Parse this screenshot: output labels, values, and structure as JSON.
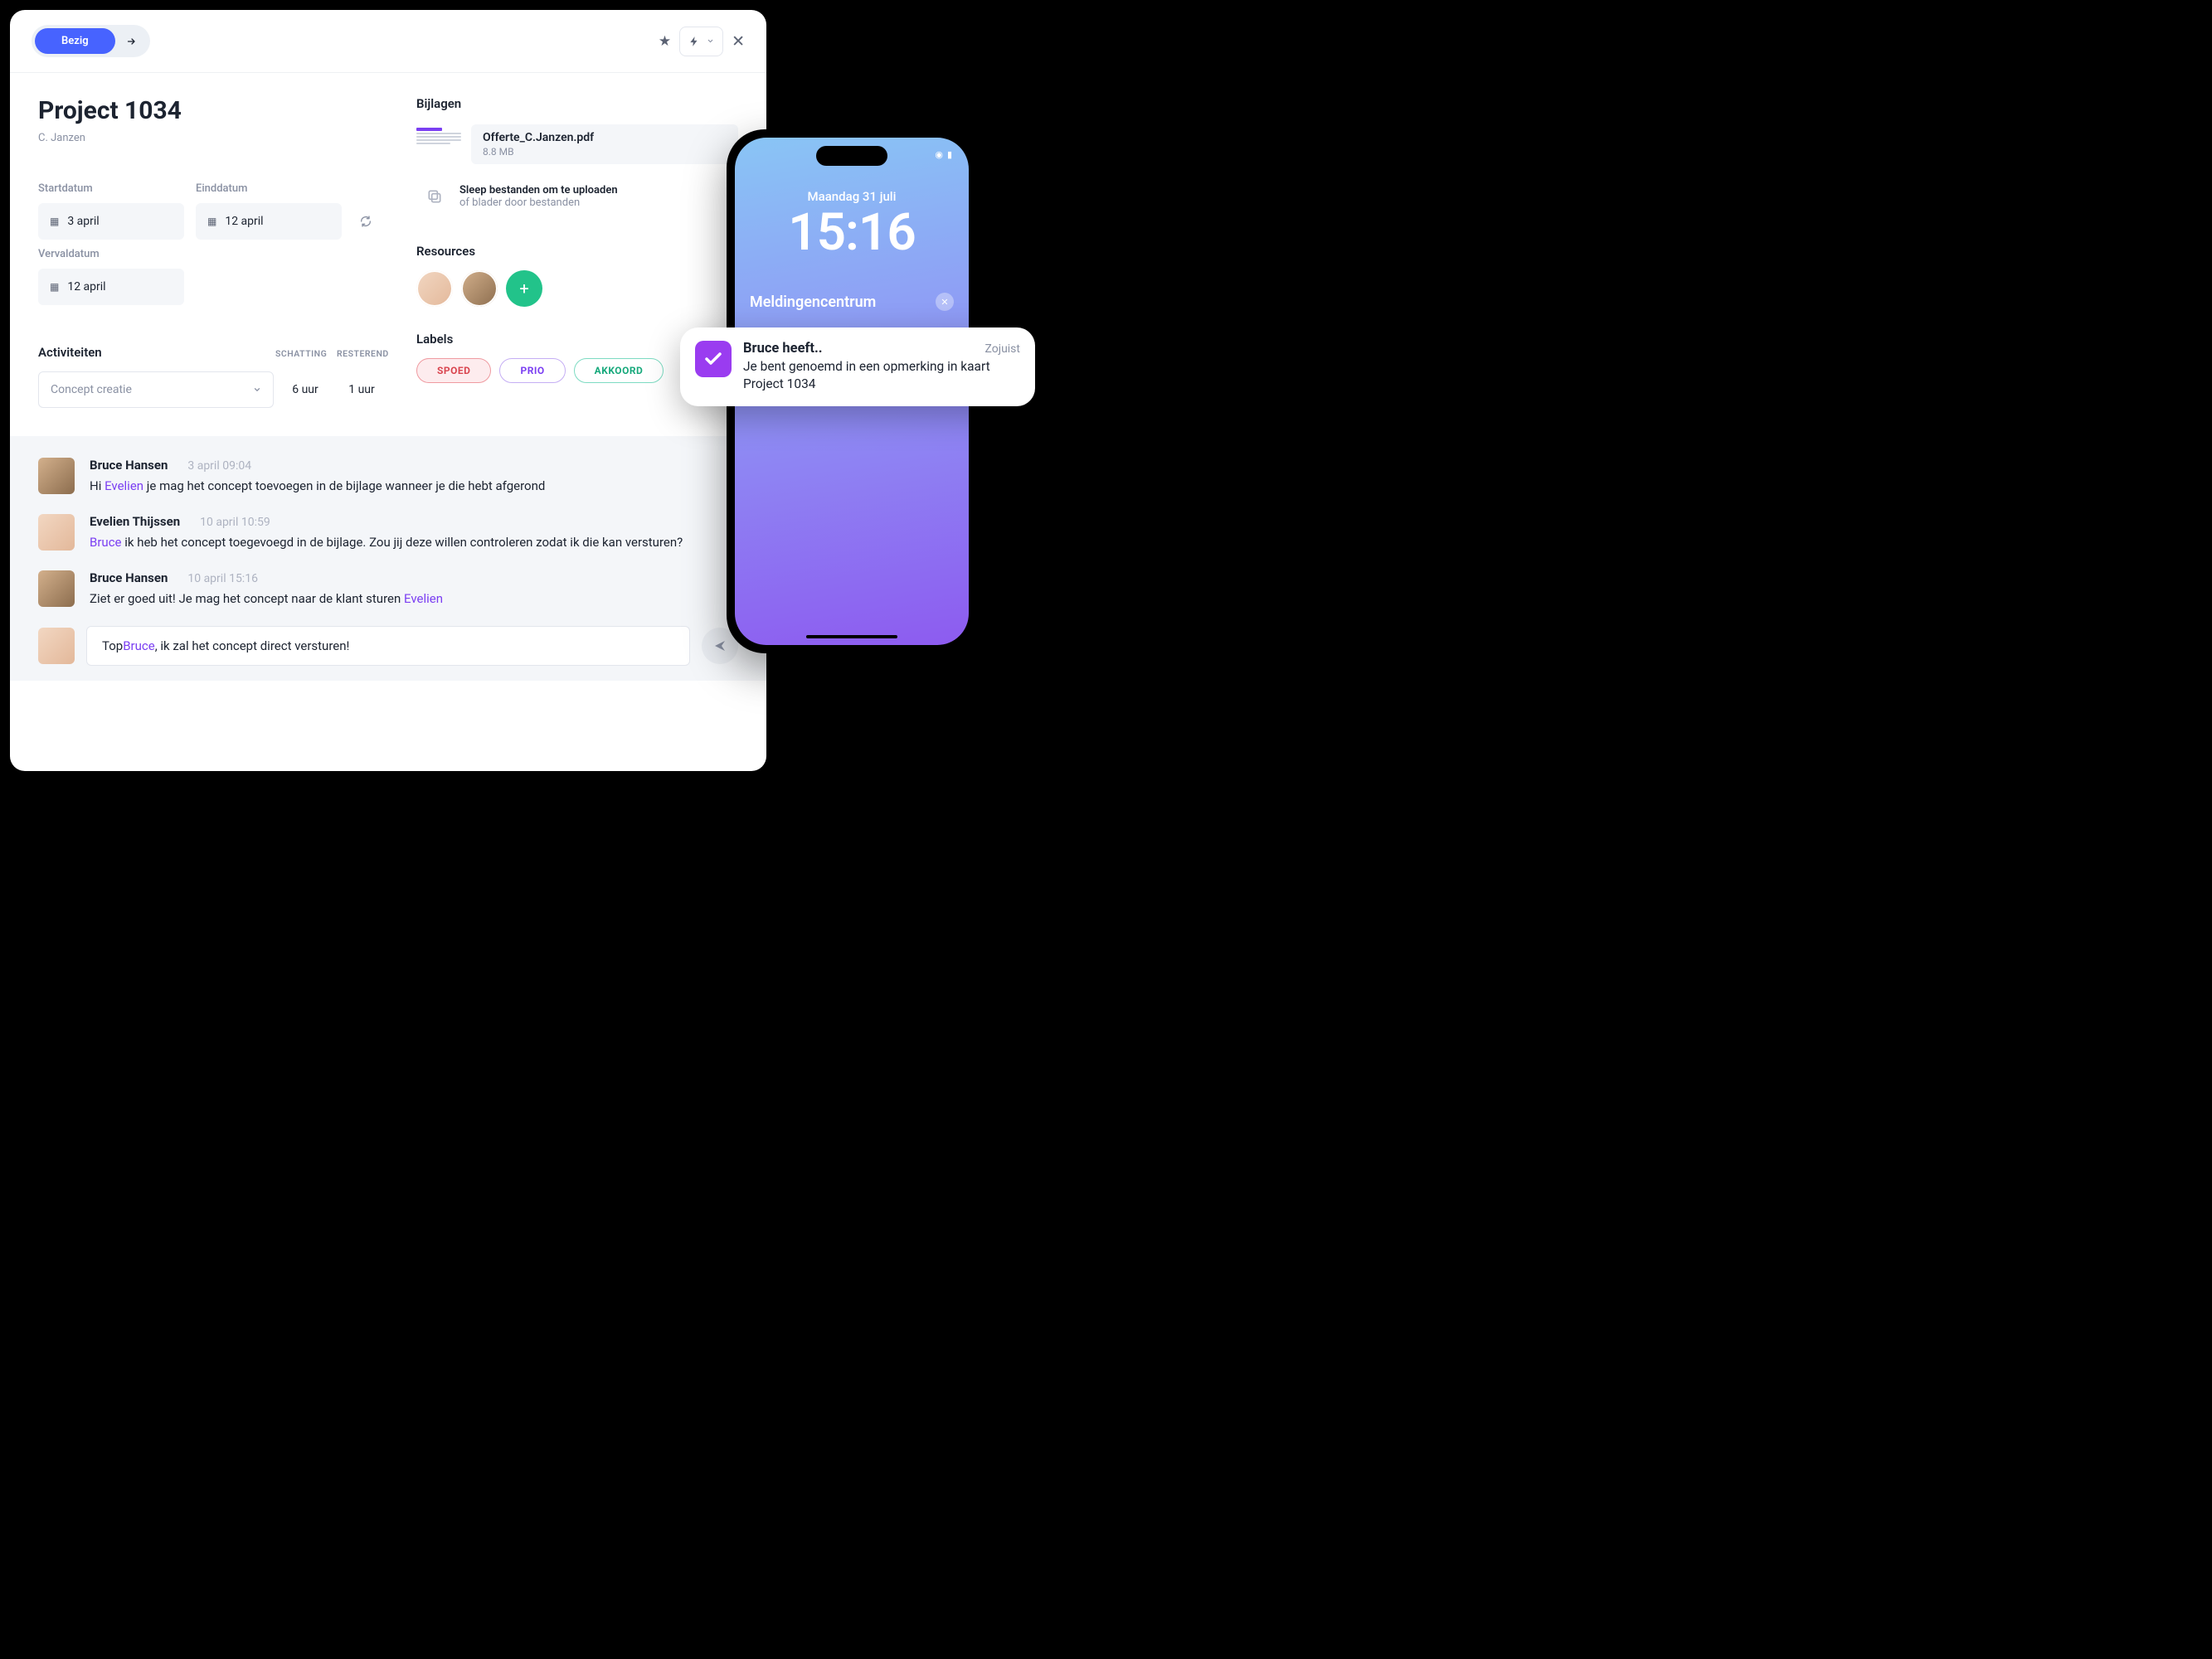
{
  "toolbar": {
    "status": "Bezig"
  },
  "project": {
    "title": "Project 1034",
    "owner": "C. Janzen"
  },
  "dates": {
    "start_label": "Startdatum",
    "start_value": "3 april",
    "end_label": "Einddatum",
    "end_value": "12 april",
    "due_label": "Vervaldatum",
    "due_value": "12 april"
  },
  "activities": {
    "title": "Activiteiten",
    "col_estimate": "SCHATTING",
    "col_remaining": "RESTEREND",
    "selected": "Concept creatie",
    "estimate": "6 uur",
    "remaining": "1 uur"
  },
  "attachments": {
    "title": "Bijlagen",
    "file_name": "Offerte_C.Janzen.pdf",
    "file_size": "8.8 MB",
    "upload_l1": "Sleep bestanden om te uploaden",
    "upload_l2": "of blader door bestanden"
  },
  "resources": {
    "title": "Resources"
  },
  "labels": {
    "title": "Labels",
    "spoed": "SPOED",
    "prio": "PRIO",
    "akkoord": "AKKOORD"
  },
  "comments": [
    {
      "author": "Bruce Hansen",
      "time": "3 april 09:04",
      "pre": "Hi ",
      "mention": "Evelien",
      "post": " je mag het concept toevoegen in de bijlage wanneer je die hebt afgerond",
      "avatar": "m"
    },
    {
      "author": "Evelien Thijssen",
      "time": "10 april 10:59",
      "pre": "",
      "mention": "Bruce",
      "post": " ik heb het concept toegevoegd in de bijlage. Zou jij deze willen controleren zodat ik die kan versturen?",
      "avatar": "f"
    },
    {
      "author": "Bruce Hansen",
      "time": "10 april 15:16",
      "pre": "Ziet er goed uit! Je mag het concept naar de klant sturen ",
      "mention": "Evelien",
      "post": "",
      "avatar": "m"
    }
  ],
  "composer": {
    "pre": "Top ",
    "mention": "Bruce",
    "post": ", ik zal het concept direct versturen!"
  },
  "phone": {
    "date": "Maandag 31 juli",
    "time": "15:16",
    "nc_title": "Meldingencentrum"
  },
  "notification": {
    "title": "Bruce heeft..",
    "time": "Zojuist",
    "text": "Je bent genoemd in een opmerking in kaart Project 1034"
  }
}
